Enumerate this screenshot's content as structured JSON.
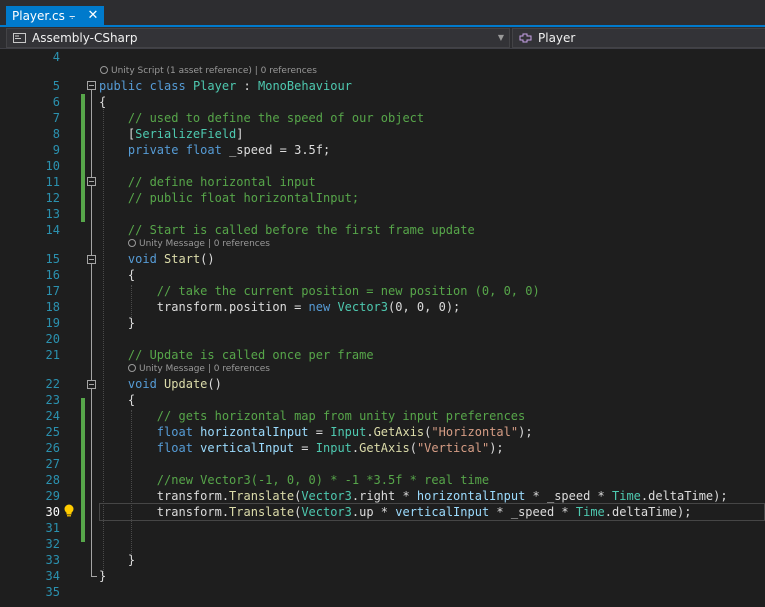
{
  "tab": {
    "title": "Player.cs",
    "pin_icon": "pin-icon",
    "close_icon": "close-icon",
    "accent": "#007acc"
  },
  "nav": {
    "project": "Assembly-CSharp",
    "member": "Player",
    "project_icon": "csharp-project-icon",
    "member_icon": "class-icon"
  },
  "colors": {
    "background": "#1e1e1e",
    "keyword": "#569cd6",
    "type": "#4ec9b0",
    "comment": "#57a64a",
    "string": "#d69d85",
    "method": "#dcdcaa",
    "line_number": "#2b91af"
  },
  "editor": {
    "current_line": 30,
    "lightbulb_icon": "lightbulb-icon",
    "codelens": {
      "class": "Unity Script (1 asset reference) | 0 references",
      "start": "Unity Message | 0 references",
      "update": "Unity Message | 0 references"
    },
    "lines": [
      {
        "n": "4",
        "tokens": []
      },
      {
        "n": "5",
        "tokens": [
          [
            "kw",
            "public"
          ],
          [
            "pl",
            " "
          ],
          [
            "kw",
            "class"
          ],
          [
            "pl",
            " "
          ],
          [
            "ty",
            "Player"
          ],
          [
            "pl",
            " : "
          ],
          [
            "ty",
            "MonoBehaviour"
          ]
        ]
      },
      {
        "n": "6",
        "tokens": [
          [
            "pl",
            "{"
          ]
        ]
      },
      {
        "n": "7",
        "tokens": [
          [
            "pl",
            "    "
          ],
          [
            "cm",
            "// used to define the speed of our object"
          ]
        ]
      },
      {
        "n": "8",
        "tokens": [
          [
            "pl",
            "    ["
          ],
          [
            "ty",
            "SerializeField"
          ],
          [
            "pl",
            "]"
          ]
        ]
      },
      {
        "n": "9",
        "tokens": [
          [
            "pl",
            "    "
          ],
          [
            "kw",
            "private"
          ],
          [
            "pl",
            " "
          ],
          [
            "kw",
            "float"
          ],
          [
            "pl",
            " _speed = 3.5f;"
          ]
        ]
      },
      {
        "n": "10",
        "tokens": []
      },
      {
        "n": "11",
        "tokens": [
          [
            "pl",
            "    "
          ],
          [
            "cm",
            "// define horizontal input"
          ]
        ]
      },
      {
        "n": "12",
        "tokens": [
          [
            "pl",
            "    "
          ],
          [
            "cm",
            "// public float horizontalInput;"
          ]
        ]
      },
      {
        "n": "13",
        "tokens": []
      },
      {
        "n": "14",
        "tokens": [
          [
            "pl",
            "    "
          ],
          [
            "cm",
            "// Start is called before the first frame update"
          ]
        ]
      },
      {
        "n": "15",
        "tokens": [
          [
            "pl",
            "    "
          ],
          [
            "kw",
            "void"
          ],
          [
            "pl",
            " "
          ],
          [
            "mt",
            "Start"
          ],
          [
            "pl",
            "()"
          ]
        ]
      },
      {
        "n": "16",
        "tokens": [
          [
            "pl",
            "    {"
          ]
        ]
      },
      {
        "n": "17",
        "tokens": [
          [
            "pl",
            "        "
          ],
          [
            "cm",
            "// take the current position = new position (0, 0, 0)"
          ]
        ]
      },
      {
        "n": "18",
        "tokens": [
          [
            "pl",
            "        transform.position = "
          ],
          [
            "kw",
            "new"
          ],
          [
            "pl",
            " "
          ],
          [
            "ty",
            "Vector3"
          ],
          [
            "pl",
            "(0, 0, 0);"
          ]
        ]
      },
      {
        "n": "19",
        "tokens": [
          [
            "pl",
            "    }"
          ]
        ]
      },
      {
        "n": "20",
        "tokens": []
      },
      {
        "n": "21",
        "tokens": [
          [
            "pl",
            "    "
          ],
          [
            "cm",
            "// Update is called once per frame"
          ]
        ]
      },
      {
        "n": "22",
        "tokens": [
          [
            "pl",
            "    "
          ],
          [
            "kw",
            "void"
          ],
          [
            "pl",
            " "
          ],
          [
            "mt",
            "Update"
          ],
          [
            "pl",
            "()"
          ]
        ]
      },
      {
        "n": "23",
        "tokens": [
          [
            "pl",
            "    {"
          ]
        ]
      },
      {
        "n": "24",
        "tokens": [
          [
            "pl",
            "        "
          ],
          [
            "cm",
            "// gets horizontal map from unity input preferences"
          ]
        ]
      },
      {
        "n": "25",
        "tokens": [
          [
            "pl",
            "        "
          ],
          [
            "kw",
            "float"
          ],
          [
            "pl",
            " "
          ],
          [
            "lv",
            "horizontalInput"
          ],
          [
            "pl",
            " = "
          ],
          [
            "ty",
            "Input"
          ],
          [
            "pl",
            "."
          ],
          [
            "mt",
            "GetAxis"
          ],
          [
            "pl",
            "("
          ],
          [
            "st",
            "\"Horizontal\""
          ],
          [
            "pl",
            ");"
          ]
        ]
      },
      {
        "n": "26",
        "tokens": [
          [
            "pl",
            "        "
          ],
          [
            "kw",
            "float"
          ],
          [
            "pl",
            " "
          ],
          [
            "lv",
            "verticalInput"
          ],
          [
            "pl",
            " = "
          ],
          [
            "ty",
            "Input"
          ],
          [
            "pl",
            "."
          ],
          [
            "mt",
            "GetAxis"
          ],
          [
            "pl",
            "("
          ],
          [
            "st",
            "\"Vertical\""
          ],
          [
            "pl",
            ");"
          ]
        ]
      },
      {
        "n": "27",
        "tokens": []
      },
      {
        "n": "28",
        "tokens": [
          [
            "pl",
            "        "
          ],
          [
            "cm",
            "//new Vector3(-1, 0, 0) * -1 *3.5f * real time"
          ]
        ]
      },
      {
        "n": "29",
        "tokens": [
          [
            "pl",
            "        transform."
          ],
          [
            "mt",
            "Translate"
          ],
          [
            "pl",
            "("
          ],
          [
            "ty",
            "Vector3"
          ],
          [
            "pl",
            ".right * "
          ],
          [
            "lv",
            "horizontalInput"
          ],
          [
            "pl",
            " * _speed * "
          ],
          [
            "ty",
            "Time"
          ],
          [
            "pl",
            ".deltaTime);"
          ]
        ]
      },
      {
        "n": "30",
        "tokens": [
          [
            "pl",
            "        transform."
          ],
          [
            "mt",
            "Translate"
          ],
          [
            "pl",
            "("
          ],
          [
            "ty",
            "Vector3"
          ],
          [
            "pl",
            ".up * "
          ],
          [
            "lv",
            "verticalInput"
          ],
          [
            "pl",
            " * _speed * "
          ],
          [
            "ty",
            "Time"
          ],
          [
            "pl",
            ".deltaTime);"
          ]
        ]
      },
      {
        "n": "31",
        "tokens": []
      },
      {
        "n": "32",
        "tokens": []
      },
      {
        "n": "33",
        "tokens": [
          [
            "pl",
            "    }"
          ]
        ]
      },
      {
        "n": "34",
        "tokens": [
          [
            "pl",
            "}"
          ]
        ]
      },
      {
        "n": "35",
        "tokens": []
      }
    ]
  }
}
